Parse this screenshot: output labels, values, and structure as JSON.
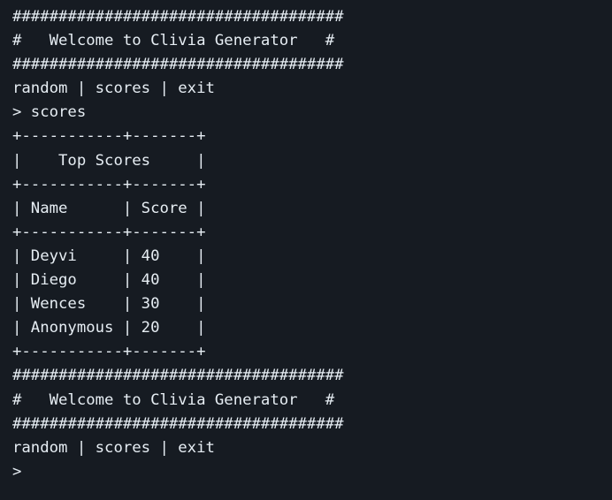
{
  "terminal": {
    "lines": [
      "####################################",
      "#   Welcome to Clivia Generator   #",
      "####################################",
      "random | scores | exit",
      "> scores",
      "+-----------+-------+",
      "|    Top Scores     |",
      "+-----------+-------+",
      "| Name      | Score |",
      "+-----------+-------+",
      "| Deyvi     | 40    |",
      "| Diego     | 40    |",
      "| Wences    | 30    |",
      "| Anonymous | 20    |",
      "+-----------+-------+",
      "####################################",
      "#   Welcome to Clivia Generator   #",
      "####################################",
      "random | scores | exit"
    ],
    "prompt": ">"
  }
}
